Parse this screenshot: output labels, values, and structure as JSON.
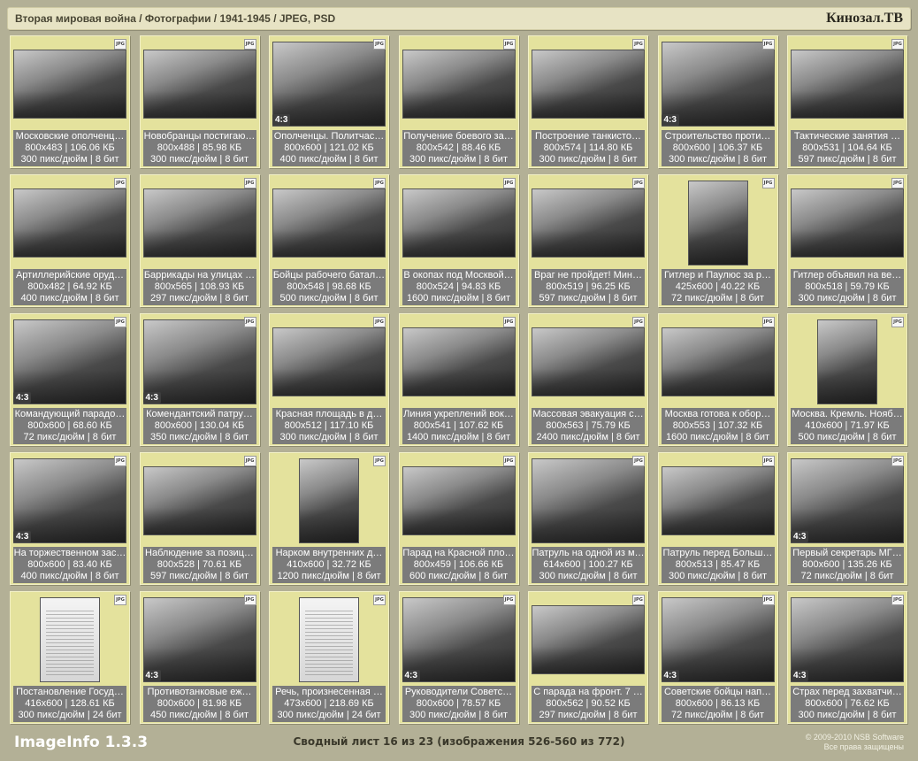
{
  "header": {
    "path": "Вторая мировая война / Фотографии / 1941-1945 / JPEG, PSD",
    "site": "Кинозал.ТВ"
  },
  "badge_label": "JPG",
  "tiles": [
    {
      "title": "Московские ополченц…",
      "size": "800x483 | 106.06 КБ",
      "res": "300 пикс/дюйм | 8 бит",
      "shape": "land",
      "ratio": ""
    },
    {
      "title": "Новобранцы постигаю…",
      "size": "800x488 | 85.98 КБ",
      "res": "300 пикс/дюйм | 8 бит",
      "shape": "land",
      "ratio": ""
    },
    {
      "title": "Ополченцы. Политчас…",
      "size": "800x600 | 121.02 КБ",
      "res": "400 пикс/дюйм | 8 бит",
      "shape": "sq",
      "ratio": "4:3"
    },
    {
      "title": "Получение боевого за…",
      "size": "800x542 | 88.46 КБ",
      "res": "300 пикс/дюйм | 8 бит",
      "shape": "land",
      "ratio": ""
    },
    {
      "title": "Построение танкисто…",
      "size": "800x574 | 114.80 КБ",
      "res": "300 пикс/дюйм | 8 бит",
      "shape": "land",
      "ratio": ""
    },
    {
      "title": "Строительство проти…",
      "size": "800x600 | 106.37 КБ",
      "res": "300 пикс/дюйм | 8 бит",
      "shape": "sq",
      "ratio": "4:3"
    },
    {
      "title": "Тактические занятия …",
      "size": "800x531 | 104.64 КБ",
      "res": "597 пикс/дюйм | 8 бит",
      "shape": "land",
      "ratio": ""
    },
    {
      "title": "Артиллерийские оруд…",
      "size": "800x482 | 64.92 КБ",
      "res": "400 пикс/дюйм | 8 бит",
      "shape": "land",
      "ratio": ""
    },
    {
      "title": "Баррикады на улицах …",
      "size": "800x565 | 108.93 КБ",
      "res": "297 пикс/дюйм | 8 бит",
      "shape": "land",
      "ratio": ""
    },
    {
      "title": "Бойцы рабочего батал…",
      "size": "800x548 | 98.68 КБ",
      "res": "500 пикс/дюйм | 8 бит",
      "shape": "land",
      "ratio": ""
    },
    {
      "title": "В окопах под Москвой…",
      "size": "800x524 | 94.83 КБ",
      "res": "1600 пикс/дюйм | 8 бит",
      "shape": "land",
      "ratio": ""
    },
    {
      "title": "Враг не пройдет! Мин…",
      "size": "800x519 | 96.25 КБ",
      "res": "597 пикс/дюйм | 8 бит",
      "shape": "land",
      "ratio": ""
    },
    {
      "title": "Гитлер и Паулюс за р…",
      "size": "425x600 | 40.22 КБ",
      "res": "72 пикс/дюйм | 8 бит",
      "shape": "por",
      "ratio": ""
    },
    {
      "title": "Гитлер объявил на ве…",
      "size": "800x518 | 59.79 КБ",
      "res": "300 пикс/дюйм | 8 бит",
      "shape": "land",
      "ratio": ""
    },
    {
      "title": "Командующий парадо…",
      "size": "800x600 | 68.60 КБ",
      "res": "72 пикс/дюйм | 8 бит",
      "shape": "sq",
      "ratio": "4:3"
    },
    {
      "title": "Комендантский патру…",
      "size": "800x600 | 130.04 КБ",
      "res": "350 пикс/дюйм | 8 бит",
      "shape": "sq",
      "ratio": "4:3"
    },
    {
      "title": "Красная площадь в д…",
      "size": "800x512 | 117.10 КБ",
      "res": "300 пикс/дюйм | 8 бит",
      "shape": "land",
      "ratio": ""
    },
    {
      "title": "Линия укреплений вок…",
      "size": "800x541 | 107.62 КБ",
      "res": "1400 пикс/дюйм | 8 бит",
      "shape": "land",
      "ratio": ""
    },
    {
      "title": "Массовая эвакуация с…",
      "size": "800x563 | 75.79 КБ",
      "res": "2400 пикс/дюйм | 8 бит",
      "shape": "land",
      "ratio": ""
    },
    {
      "title": "Москва готова к обор…",
      "size": "800x553 | 107.32 КБ",
      "res": "1600 пикс/дюйм | 8 бит",
      "shape": "land",
      "ratio": ""
    },
    {
      "title": "Москва. Кремль. Нояб…",
      "size": "410x600 | 71.97 КБ",
      "res": "500 пикс/дюйм | 8 бит",
      "shape": "por",
      "ratio": ""
    },
    {
      "title": "На торжественном зас…",
      "size": "800x600 | 83.40 КБ",
      "res": "400 пикс/дюйм | 8 бит",
      "shape": "sq",
      "ratio": "4:3"
    },
    {
      "title": "Наблюдение за позиц…",
      "size": "800x528 | 70.61 КБ",
      "res": "597 пикс/дюйм | 8 бит",
      "shape": "land",
      "ratio": ""
    },
    {
      "title": "Нарком внутренних д…",
      "size": "410x600 | 32.72 КБ",
      "res": "1200 пикс/дюйм | 8 бит",
      "shape": "por",
      "ratio": ""
    },
    {
      "title": "Парад на Красной пло…",
      "size": "800x459 | 106.66 КБ",
      "res": "600 пикс/дюйм | 8 бит",
      "shape": "land",
      "ratio": ""
    },
    {
      "title": "Патруль на одной из м…",
      "size": "614x600 | 100.27 КБ",
      "res": "300 пикс/дюйм | 8 бит",
      "shape": "sq",
      "ratio": ""
    },
    {
      "title": "Патруль перед Больш…",
      "size": "800x513 | 85.47 КБ",
      "res": "300 пикс/дюйм | 8 бит",
      "shape": "land",
      "ratio": ""
    },
    {
      "title": "Первый секретарь МГ…",
      "size": "800x600 | 135.26 КБ",
      "res": "72 пикс/дюйм | 8 бит",
      "shape": "sq",
      "ratio": "4:3"
    },
    {
      "title": "Постановление Госуд…",
      "size": "416x600 | 128.61 КБ",
      "res": "300 пикс/дюйм | 24 бит",
      "shape": "por doc",
      "ratio": ""
    },
    {
      "title": "Противотанковые еж…",
      "size": "800x600 | 81.98 КБ",
      "res": "450 пикс/дюйм | 8 бит",
      "shape": "sq",
      "ratio": "4:3"
    },
    {
      "title": "Речь, произнесенная …",
      "size": "473x600 | 218.69 КБ",
      "res": "300 пикс/дюйм | 24 бит",
      "shape": "por doc",
      "ratio": ""
    },
    {
      "title": "Руководители Советс…",
      "size": "800x600 | 78.57 КБ",
      "res": "300 пикс/дюйм | 8 бит",
      "shape": "sq",
      "ratio": "4:3"
    },
    {
      "title": "С парада на фронт. 7 …",
      "size": "800x562 | 90.52 КБ",
      "res": "297 пикс/дюйм | 8 бит",
      "shape": "land",
      "ratio": ""
    },
    {
      "title": "Советские бойцы нап…",
      "size": "800x600 | 86.13 КБ",
      "res": "72 пикс/дюйм | 8 бит",
      "shape": "sq",
      "ratio": "4:3"
    },
    {
      "title": "Страх перед захватчи…",
      "size": "800x600 | 76.62 КБ",
      "res": "300 пикс/дюйм | 8 бит",
      "shape": "sq",
      "ratio": "4:3"
    }
  ],
  "footer": {
    "logo": "ImageInfo 1.3.3",
    "summary": "Сводный лист 16 из 23 (изображения 526-560 из 772)",
    "copyright_line1": "© 2009-2010 NSB Software",
    "copyright_line2": "Все права защищены"
  }
}
